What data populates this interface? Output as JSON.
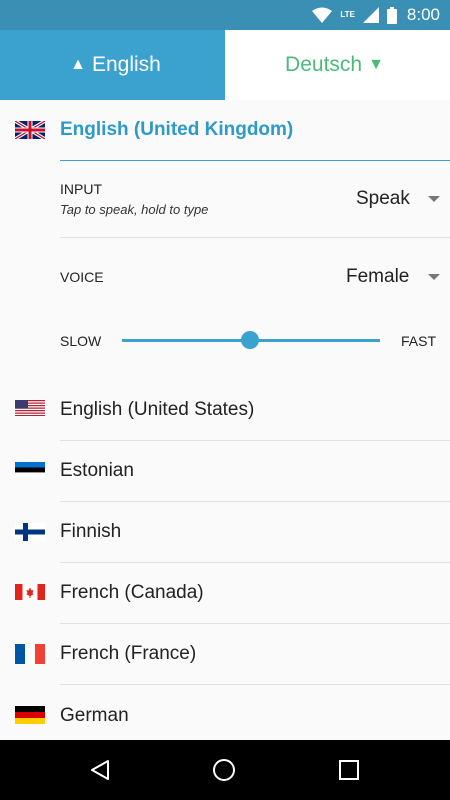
{
  "status": {
    "network": "LTE",
    "time": "8:00"
  },
  "tabs": {
    "source": {
      "arrow": "▲",
      "label": "English"
    },
    "target": {
      "label": "Deutsch",
      "arrow": "▼"
    }
  },
  "selected_language": {
    "label": "English (United Kingdom)",
    "flag": "uk-flag"
  },
  "settings": {
    "input": {
      "label": "INPUT",
      "hint": "Tap to speak, hold to type",
      "value": "Speak"
    },
    "voice": {
      "label": "VOICE",
      "value": "Female"
    },
    "speed": {
      "slow": "SLOW",
      "fast": "FAST",
      "level": 0.5
    }
  },
  "languages": [
    {
      "label": "English (United States)",
      "flag": "us-flag"
    },
    {
      "label": "Estonian",
      "flag": "estonia-flag"
    },
    {
      "label": "Finnish",
      "flag": "finland-flag"
    },
    {
      "label": "French (Canada)",
      "flag": "canada-flag"
    },
    {
      "label": "French (France)",
      "flag": "france-flag"
    },
    {
      "label": "German",
      "flag": "germany-flag"
    }
  ],
  "colors": {
    "accent": "#3ba2cf",
    "status_bar": "#3a8fb4",
    "target_tab_text": "#4cbb7a"
  }
}
